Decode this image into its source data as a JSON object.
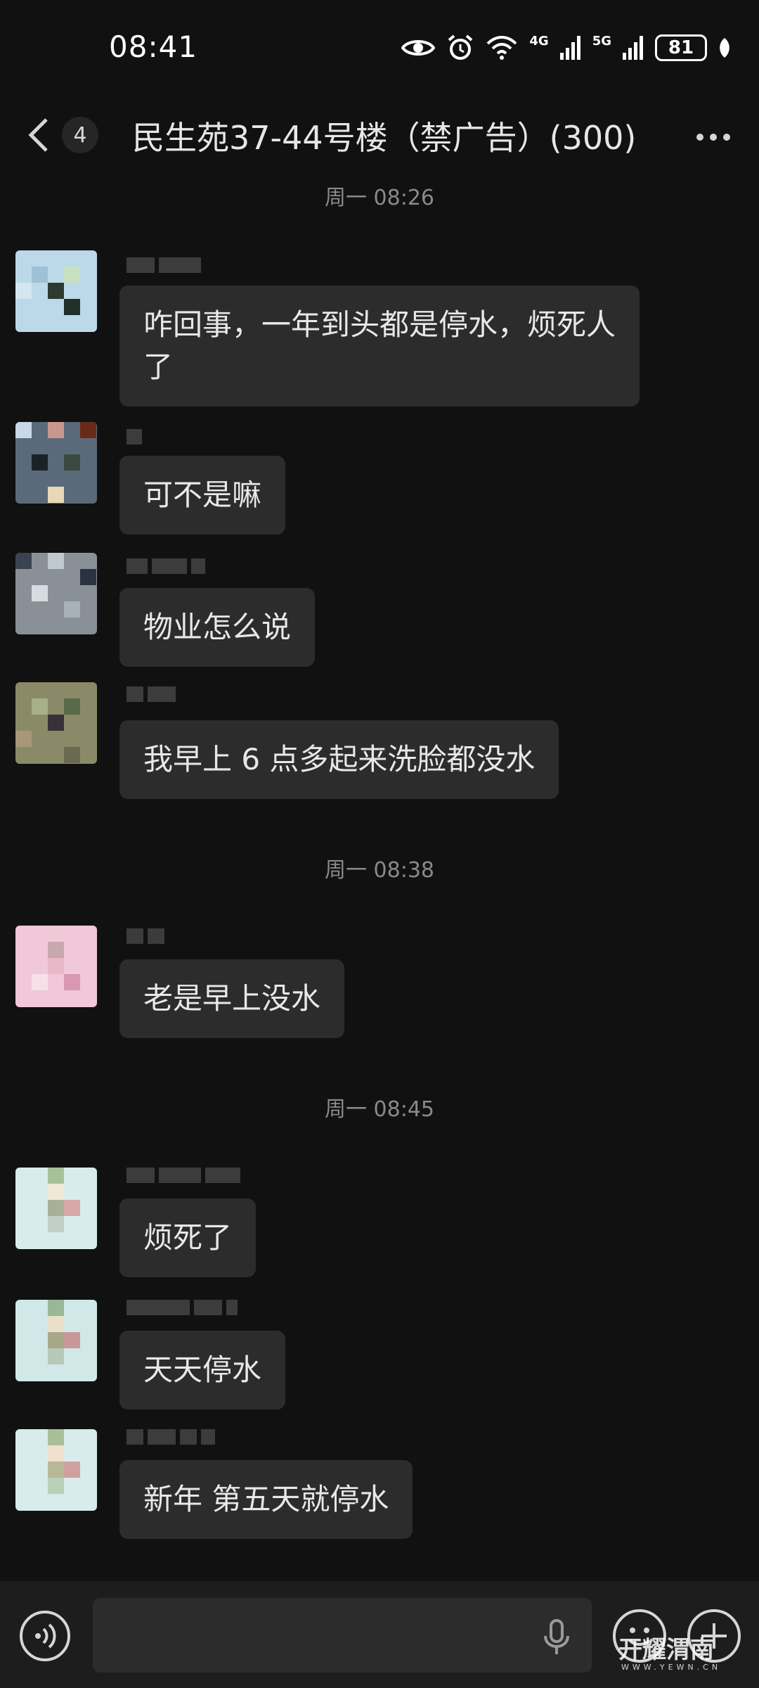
{
  "status_bar": {
    "time": "08:41",
    "network_1": "4G",
    "network_2": "5G",
    "battery": "81"
  },
  "header": {
    "unread_count": "4",
    "title": "民生苑37-44号楼（禁广告）(300)"
  },
  "timestamps": [
    "周一 08:26",
    "周一 08:38",
    "周一 08:45"
  ],
  "messages": [
    {
      "text": "咋回事，一年到头都是停水，烦死人了"
    },
    {
      "text": "可不是嘛"
    },
    {
      "text": "物业怎么说"
    },
    {
      "text": "我早上 6 点多起来洗脸都没水"
    },
    {
      "text": "老是早上没水"
    },
    {
      "text": "烦死了"
    },
    {
      "text": "天天停水"
    },
    {
      "text": "新年 第五天就停水"
    }
  ],
  "watermark": {
    "text": "开耀渭南",
    "sub": "WWW.YEWN.CN"
  },
  "icons": {
    "back": "chevron-left-icon",
    "more": "more-dots-icon",
    "voice": "voice-icon",
    "mic": "mic-icon",
    "emoji": "emoji-icon",
    "plus": "plus-icon"
  }
}
